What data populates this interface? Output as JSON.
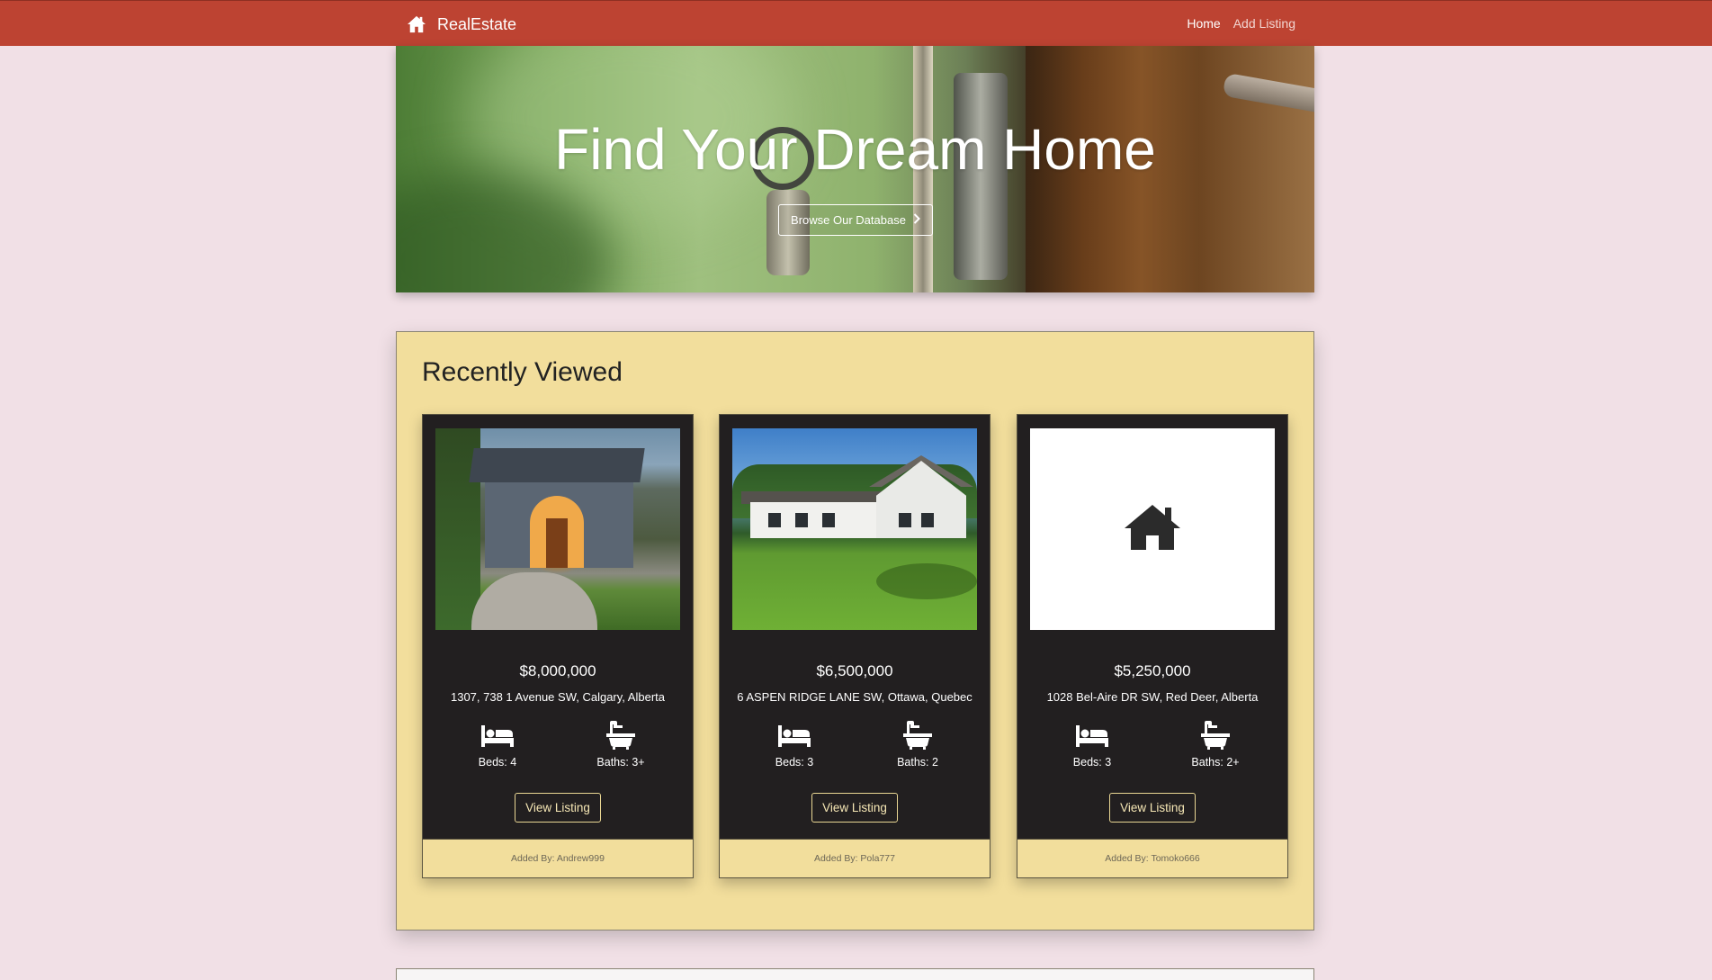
{
  "navbar": {
    "brand_text": "RealEstate",
    "links": [
      {
        "label": "Home",
        "active": true
      },
      {
        "label": "Add Listing",
        "active": false
      }
    ],
    "color": "#bd4332"
  },
  "hero": {
    "title": "Find Your Dream Home",
    "button_label": "Browse Our Database"
  },
  "recent": {
    "title": "Recently Viewed",
    "panel_color": "#f2de9c",
    "cards": [
      {
        "image": "house-photo-evening",
        "price": "$8,000,000",
        "address": "1307, 738 1 Avenue SW, Calgary, Alberta",
        "beds": "Beds: 4",
        "baths": "Baths: 3+",
        "button": "View Listing",
        "added_by": "Added By: Andrew999"
      },
      {
        "image": "house-photo-lawn",
        "price": "$6,500,000",
        "address": "6 ASPEN RIDGE LANE SW, Ottawa, Quebec",
        "beds": "Beds: 3",
        "baths": "Baths: 2",
        "button": "View Listing",
        "added_by": "Added By: Pola777"
      },
      {
        "image": "home-icon-placeholder",
        "price": "$5,250,000",
        "address": "1028 Bel-Aire DR SW, Red Deer, Alberta",
        "beds": "Beds: 3",
        "baths": "Baths: 2+",
        "button": "View Listing",
        "added_by": "Added By: Tomoko666"
      }
    ]
  }
}
